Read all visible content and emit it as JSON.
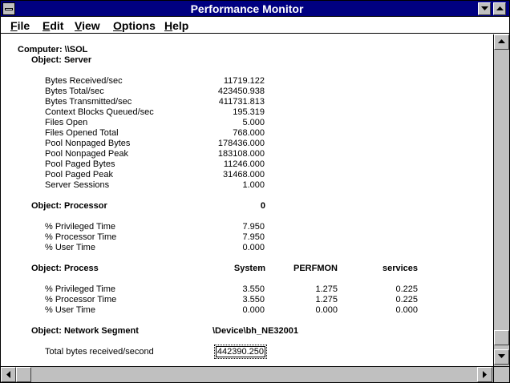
{
  "window": {
    "title": "Performance Monitor"
  },
  "menu": {
    "file": {
      "u": "F",
      "rest": "ile"
    },
    "edit": {
      "u": "E",
      "rest": "dit"
    },
    "view": {
      "u": "V",
      "rest": "iew"
    },
    "options": {
      "u": "O",
      "rest": "ptions"
    },
    "help": {
      "u": "H",
      "rest": "elp"
    }
  },
  "report": {
    "computer": "Computer: \\\\SOL",
    "server": {
      "header": "Object: Server",
      "counters": [
        {
          "name": "Bytes Received/sec",
          "value": "11719.122"
        },
        {
          "name": "Bytes Total/sec",
          "value": "423450.938"
        },
        {
          "name": "Bytes Transmitted/sec",
          "value": "411731.813"
        },
        {
          "name": "Context Blocks Queued/sec",
          "value": "195.319"
        },
        {
          "name": "Files Open",
          "value": "5.000"
        },
        {
          "name": "Files Opened Total",
          "value": "768.000"
        },
        {
          "name": "Pool Nonpaged Bytes",
          "value": "178436.000"
        },
        {
          "name": "Pool Nonpaged Peak",
          "value": "183108.000"
        },
        {
          "name": "Pool Paged Bytes",
          "value": "11246.000"
        },
        {
          "name": "Pool Paged Peak",
          "value": "31468.000"
        },
        {
          "name": "Server Sessions",
          "value": "1.000"
        }
      ]
    },
    "processor": {
      "header": "Object: Processor",
      "instance": "0",
      "counters": [
        {
          "name": "% Privileged Time",
          "value": "7.950"
        },
        {
          "name": "% Processor Time",
          "value": "7.950"
        },
        {
          "name": "% User Time",
          "value": "0.000"
        }
      ]
    },
    "process": {
      "header": "Object: Process",
      "instances": [
        "System",
        "PERFMON",
        "services"
      ],
      "counters": [
        {
          "name": "% Privileged Time",
          "values": [
            "3.550",
            "1.275",
            "0.225"
          ]
        },
        {
          "name": "% Processor Time",
          "values": [
            "3.550",
            "1.275",
            "0.225"
          ]
        },
        {
          "name": "% User Time",
          "values": [
            "0.000",
            "0.000",
            "0.000"
          ]
        }
      ]
    },
    "network": {
      "header": "Object: Network Segment",
      "instance": "\\Device\\bh_NE32001",
      "counters": [
        {
          "name": "Total bytes received/second",
          "value": "442390.250"
        }
      ]
    }
  }
}
